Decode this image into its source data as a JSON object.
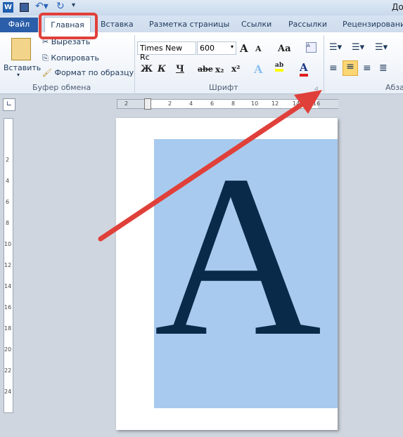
{
  "title_bar": {
    "title": "До",
    "quick_access": [
      "word-icon",
      "save-icon",
      "undo-icon",
      "redo-icon",
      "customize-icon"
    ]
  },
  "tabs": [
    {
      "label": "Файл"
    },
    {
      "label": "Главная",
      "active": true
    },
    {
      "label": "Вставка"
    },
    {
      "label": "Разметка страницы"
    },
    {
      "label": "Ссылки"
    },
    {
      "label": "Рассылки"
    },
    {
      "label": "Рецензирование"
    }
  ],
  "clipboard": {
    "paste": "Вставить",
    "cut": "Вырезать",
    "copy": "Копировать",
    "format_painter": "Формат по образцу",
    "group_label": "Буфер обмена"
  },
  "font": {
    "font_name": "Times New Rc",
    "font_size": "600",
    "bold": "Ж",
    "italic": "К",
    "underline": "Ч",
    "strike": "abe",
    "sub": "x₂",
    "sup": "x²",
    "change_case": "Aa",
    "grow": "A",
    "shrink": "A",
    "text_effects": "A",
    "highlight": "ab",
    "font_color": "A",
    "group_label": "Шрифт",
    "font_color_value": "#e0201c",
    "highlight_color": "#ffff00"
  },
  "paragraph": {
    "group_label": "Абза",
    "align_center_active": true
  },
  "ruler": {
    "h_labels": [
      "2",
      "2",
      "4",
      "6",
      "8",
      "10",
      "12",
      "14",
      "16"
    ],
    "v_labels": [
      "2",
      "4",
      "6",
      "8",
      "10",
      "12",
      "14",
      "16",
      "18",
      "20",
      "22",
      "24"
    ]
  },
  "document": {
    "letter": "A",
    "background_color": "#a8caee",
    "letter_color": "#0a2a4a"
  },
  "annotation": {
    "color": "#e0403a"
  }
}
